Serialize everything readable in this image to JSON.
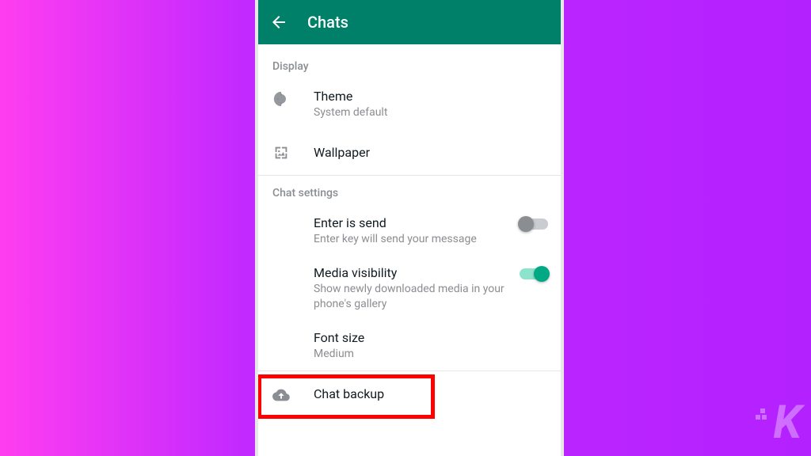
{
  "appbar": {
    "title": "Chats"
  },
  "sections": {
    "display": {
      "header": "Display",
      "theme": {
        "title": "Theme",
        "subtitle": "System default"
      },
      "wallpaper": {
        "title": "Wallpaper"
      }
    },
    "chat_settings": {
      "header": "Chat settings",
      "enter_is_send": {
        "title": "Enter is send",
        "subtitle": "Enter key will send your message",
        "enabled": false
      },
      "media_visibility": {
        "title": "Media visibility",
        "subtitle": "Show newly downloaded media in your phone's gallery",
        "enabled": true
      },
      "font_size": {
        "title": "Font size",
        "subtitle": "Medium"
      },
      "chat_backup": {
        "title": "Chat backup"
      }
    }
  },
  "watermark": "K",
  "colors": {
    "primary": "#008069",
    "accent": "#00a884",
    "highlight": "#ff0000"
  }
}
